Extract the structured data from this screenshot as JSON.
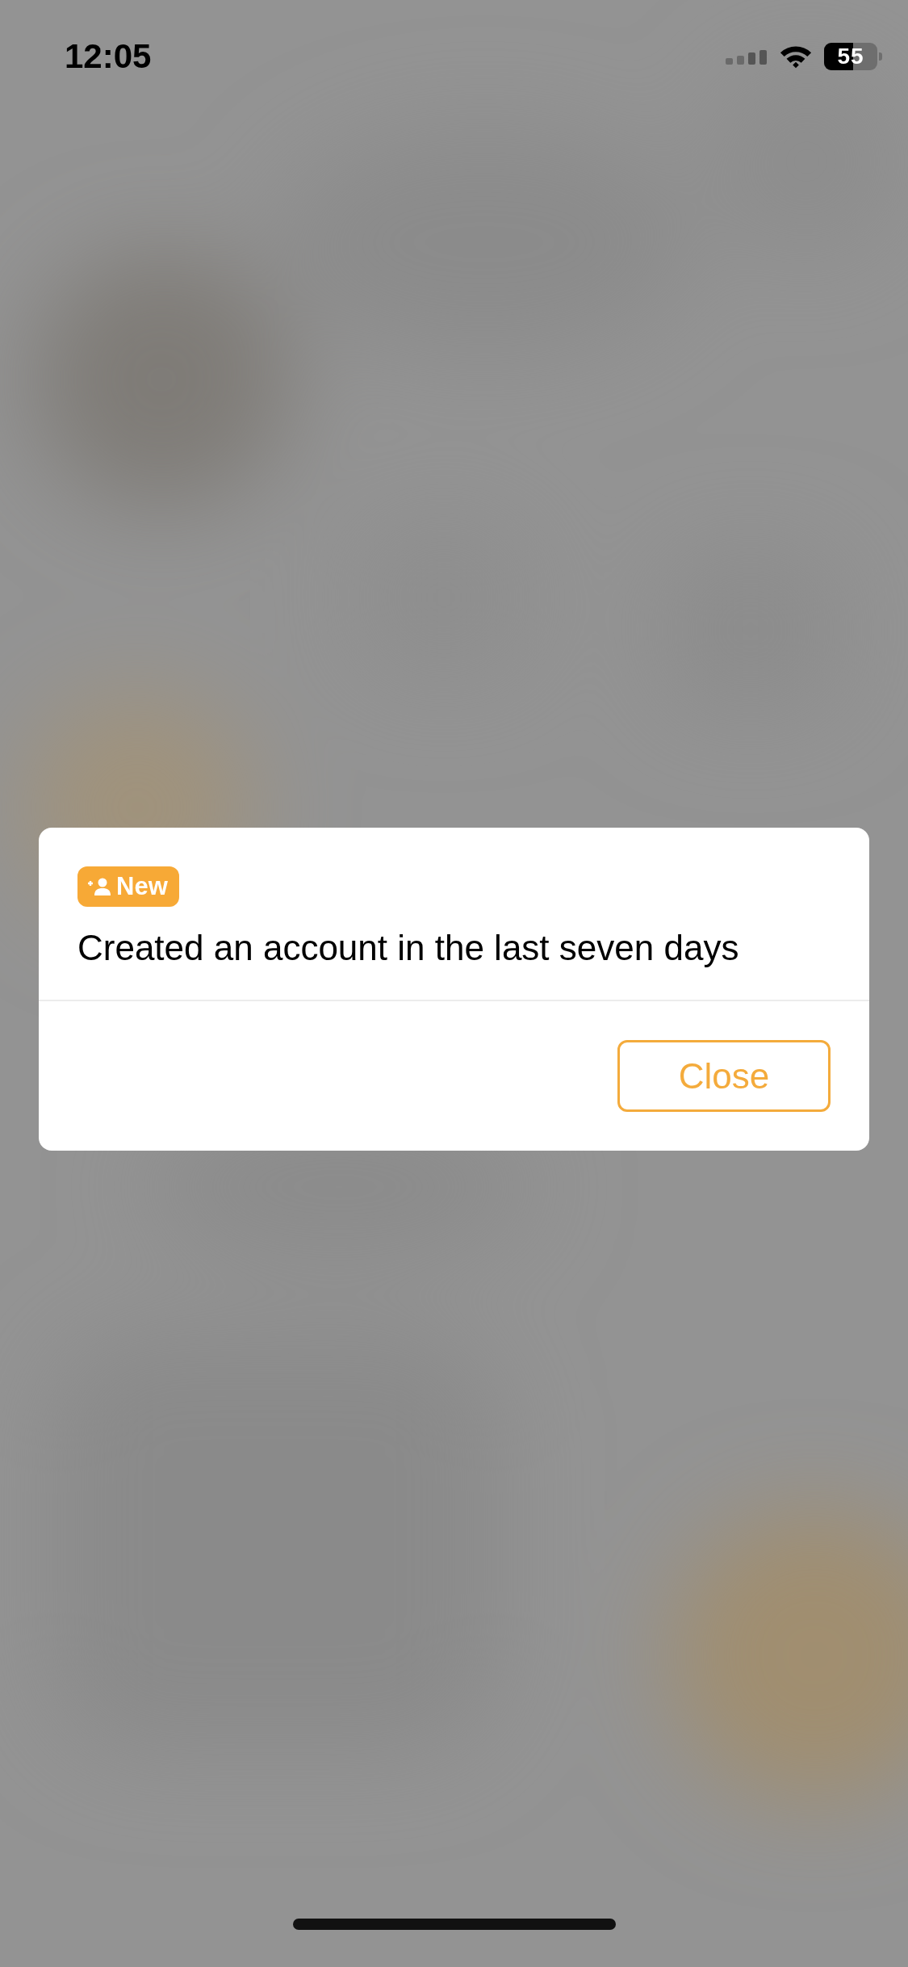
{
  "status_bar": {
    "time": "12:05",
    "battery": "55"
  },
  "dialog": {
    "badge": {
      "kind": "new-user",
      "label": "New"
    },
    "message": "Created an account in the last seven days",
    "buttons": [
      {
        "label": "Close"
      }
    ]
  }
}
